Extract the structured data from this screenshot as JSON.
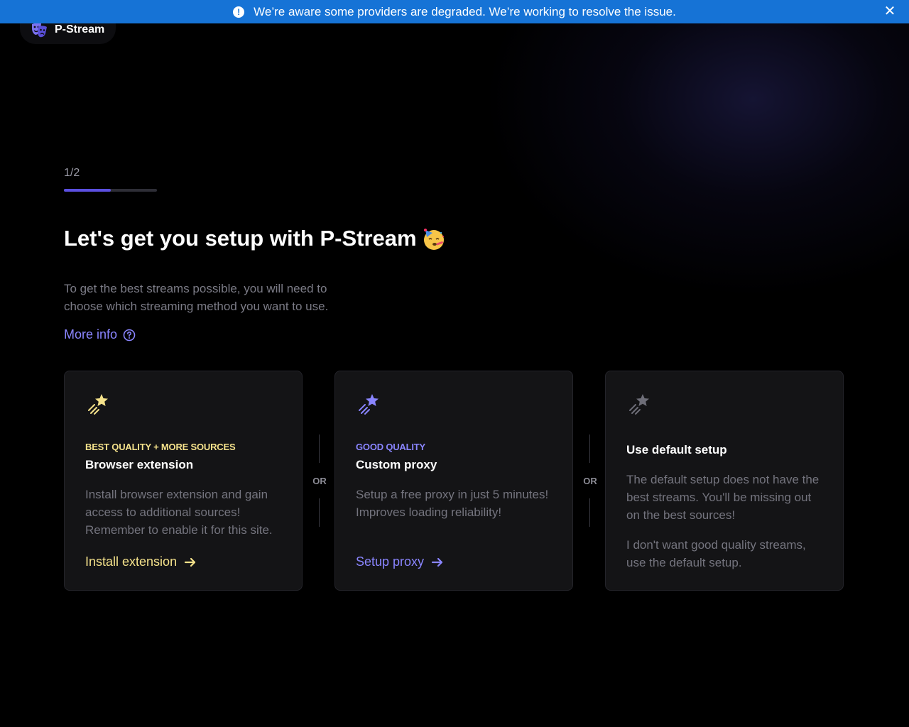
{
  "banner": {
    "icon": "exclamation-circle-icon",
    "text": "We’re aware some providers are degraded. We’re working to resolve the issue.",
    "close_icon": "close-icon",
    "color": "#1673d6"
  },
  "logo": {
    "icon": "theater-masks-icon",
    "text": "P-Stream"
  },
  "progress": {
    "step_label": "1/2",
    "fraction": 0.5
  },
  "title": {
    "text": "Let's get you setup with P-Stream",
    "emoji": "partying-face-emoji"
  },
  "description": "To get the best streams possible, you will need to choose which streaming method you want to use.",
  "more_info": {
    "label": "More info",
    "icon": "question-circle-icon"
  },
  "separator_label": "OR",
  "cards": [
    {
      "icon": "shooting-star-icon",
      "tag": "BEST QUALITY + MORE SOURCES",
      "title": "Browser extension",
      "text": "Install browser extension and gain access to additional sources! Remember to enable it for this site.",
      "action": "Install extension",
      "accent": "#f5e28b"
    },
    {
      "icon": "shooting-star-icon",
      "tag": "GOOD QUALITY",
      "title": "Custom proxy",
      "text": "Setup a free proxy in just 5 minutes! Improves loading reliability!",
      "action": "Setup proxy",
      "accent": "#8a85ff"
    },
    {
      "icon": "shooting-star-icon",
      "title": "Use default setup",
      "text": "The default setup does not have the best streams. You'll be missing out on the best sources!",
      "text2": "I don't want good quality streams, use the default setup.",
      "accent": "#6e6e78"
    }
  ]
}
